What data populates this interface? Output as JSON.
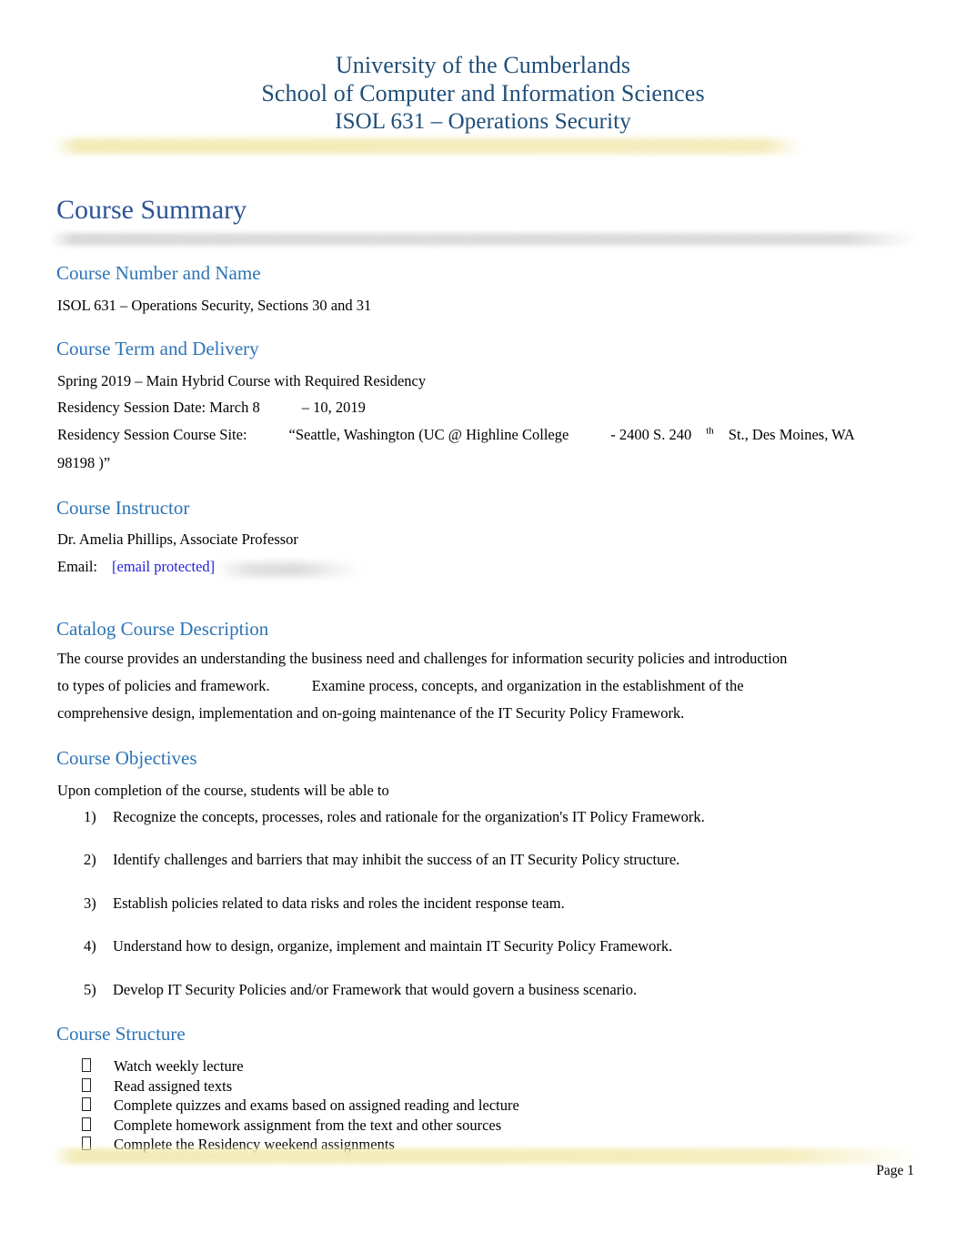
{
  "document": {
    "header": {
      "line1": "University of the Cumberlands",
      "line2": "School of Computer and Information Sciences",
      "line3": "ISOL 631  – Operations Security"
    },
    "page_title": "Course Summary",
    "footer": {
      "page_label": "Page 1"
    }
  },
  "sections": {
    "course_number": {
      "heading": "Course Number and Name",
      "value": "ISOL 631  – Operations Security, Sections 30 and 31"
    },
    "course_term": {
      "heading": "Course Term and Delivery",
      "line1": "Spring 2019   – Main Hybrid Course with Required Residency",
      "line2_label": "Residency Session Date: March 8",
      "line2_value": "– 10, 2019",
      "line3_label": "Residency Session Course Site:",
      "line3_part1": "“Seattle, Washington (UC @ Highline College",
      "line3_part2": "- 2400 S. 240",
      "line3_ordinal": "th",
      "line3_part3": "St., Des Moines, WA",
      "line4": "98198 )”"
    },
    "course_instructor": {
      "heading": "Course Instructor",
      "name": "Dr. Amelia Phillips, Associate Professor",
      "email_label": "Email:",
      "email_value": "[email protected]"
    },
    "catalog_description": {
      "heading": "Catalog Course Description",
      "line1": "The course provides an understanding the business need and challenges for information security policies and introduction",
      "line2_a": "to types of policies and framework.",
      "line2_b": "Examine process, concepts, and organization in the establishment of the",
      "line3": "comprehensive design, implementation and on-going maintenance of the IT Security Policy Framework."
    },
    "course_objectives": {
      "heading": "Course Objectives",
      "intro": "Upon completion of the course, students will be able to",
      "items": [
        {
          "marker": "1)",
          "text": "Recognize the concepts, processes, roles and rationale for the organization's IT Policy Framework."
        },
        {
          "marker": "2)",
          "text": "Identify challenges and barriers that may inhibit the success of an IT Security Policy structure."
        },
        {
          "marker": "3)",
          "text": "Establish policies related to data risks and roles the incident response team."
        },
        {
          "marker": "4)",
          "text": "Understand how to design, organize, implement and maintain IT Security Policy Framework."
        },
        {
          "marker": "5)",
          "text": "Develop IT Security Policies and/or Framework that would govern a business scenario."
        }
      ]
    },
    "course_structure": {
      "heading": "Course Structure",
      "items": [
        "Watch weekly lecture",
        "Read assigned texts",
        "Complete quizzes and exams based on assigned reading and lecture",
        "Complete homework assignment from the text and other sources",
        "Complete the Residency weekend assignments"
      ]
    }
  },
  "colors": {
    "header_title": "#1F4E79",
    "heading1": "#2F5496",
    "heading2": "#2E74B5",
    "link": "#2323DC",
    "header_rule": "#F2EAB2",
    "summary_rule": "#DBDBDB",
    "footer_rule": "#F3EBB4",
    "body_text": "#000000"
  }
}
